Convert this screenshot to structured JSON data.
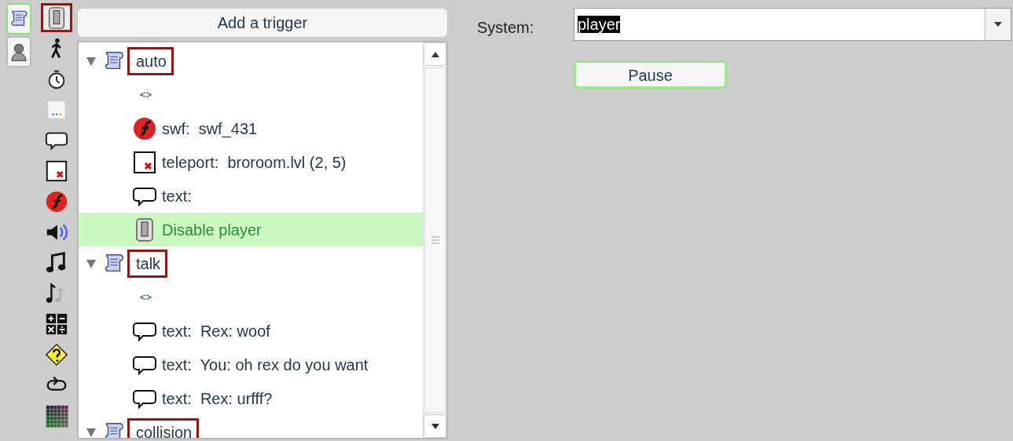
{
  "palette": [
    {
      "kind": "script",
      "selected": true
    },
    {
      "kind": "character",
      "selected": false
    }
  ],
  "tools": [
    {
      "kind": "switch",
      "selected": true
    },
    {
      "kind": "walker",
      "selected": false
    },
    {
      "kind": "timer",
      "selected": false
    },
    {
      "kind": "dots",
      "selected": false
    },
    {
      "kind": "speech",
      "selected": false
    },
    {
      "kind": "teleport",
      "selected": false
    },
    {
      "kind": "flash",
      "selected": false
    },
    {
      "kind": "speaker",
      "selected": false
    },
    {
      "kind": "note",
      "selected": false
    },
    {
      "kind": "notes",
      "selected": false
    },
    {
      "kind": "calc",
      "selected": false
    },
    {
      "kind": "question",
      "selected": false
    },
    {
      "kind": "loop",
      "selected": false
    },
    {
      "kind": "grid",
      "selected": false
    }
  ],
  "add_trigger_button": "Add a trigger",
  "triggers": [
    {
      "name": "auto",
      "expanded": true,
      "children": [
        {
          "kind": "tag",
          "label": "<>",
          "selected": false
        },
        {
          "kind": "flash",
          "label": "swf:  swf_431",
          "selected": false
        },
        {
          "kind": "teleport",
          "label": "teleport:  broroom.lvl (2, 5)",
          "selected": false
        },
        {
          "kind": "speech",
          "label": "text:",
          "selected": false
        },
        {
          "kind": "switch",
          "label": "Disable player",
          "selected": true
        }
      ]
    },
    {
      "name": "talk",
      "expanded": true,
      "children": [
        {
          "kind": "tag",
          "label": "<>",
          "selected": false
        },
        {
          "kind": "speech",
          "label": "text:  Rex: woof",
          "selected": false
        },
        {
          "kind": "speech",
          "label": "text:  You: oh rex do you want",
          "selected": false
        },
        {
          "kind": "speech",
          "label": "text:  Rex: urfff?",
          "selected": false
        }
      ]
    },
    {
      "name": "collision",
      "expanded": true
    }
  ],
  "system": {
    "label": "System:",
    "value": "player"
  },
  "pause_button": "Pause"
}
